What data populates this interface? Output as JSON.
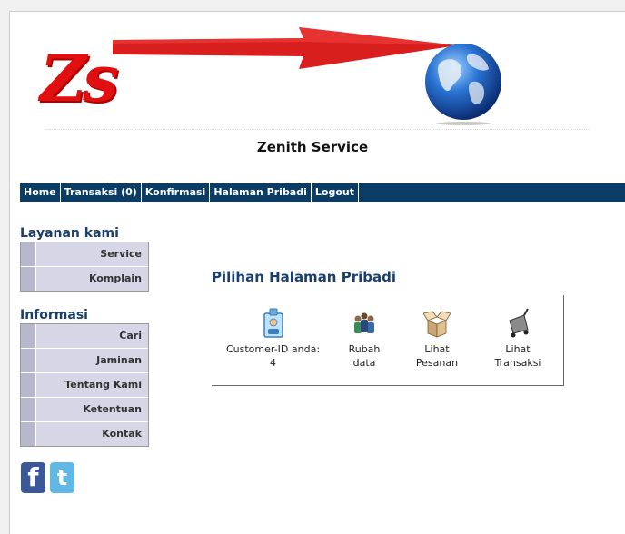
{
  "header": {
    "logo_text": "Zs",
    "site_title": "Zenith Service"
  },
  "nav": [
    {
      "label": "Home"
    },
    {
      "label": "Transaksi (0)"
    },
    {
      "label": "Konfirmasi"
    },
    {
      "label": "Halaman Pribadi"
    },
    {
      "label": "Logout"
    }
  ],
  "sidebar": {
    "layanan_heading": "Layanan kami",
    "layanan_items": [
      {
        "label": "Service"
      },
      {
        "label": "Komplain"
      }
    ],
    "informasi_heading": "Informasi",
    "informasi_items": [
      {
        "label": "Cari"
      },
      {
        "label": "Jaminan"
      },
      {
        "label": "Tentang Kami"
      },
      {
        "label": "Ketentuan"
      },
      {
        "label": "Kontak"
      }
    ],
    "social": {
      "facebook_letter": "f",
      "twitter_letter": "t"
    }
  },
  "main": {
    "heading": "Pilihan Halaman Pribadi",
    "tiles": [
      {
        "line1": "Customer-ID anda:",
        "line2": "4",
        "icon": "id-card-icon"
      },
      {
        "line1": "Rubah",
        "line2": "data",
        "icon": "people-icon"
      },
      {
        "line1": "Lihat",
        "line2": "Pesanan",
        "icon": "box-icon"
      },
      {
        "line1": "Lihat",
        "line2": "Transaksi",
        "icon": "cart-icon"
      }
    ]
  },
  "colors": {
    "nav_bg": "#0b3c66",
    "heading": "#1a3f6e",
    "logo_red": "#e01010",
    "menu_bg": "#d6d6e6"
  }
}
